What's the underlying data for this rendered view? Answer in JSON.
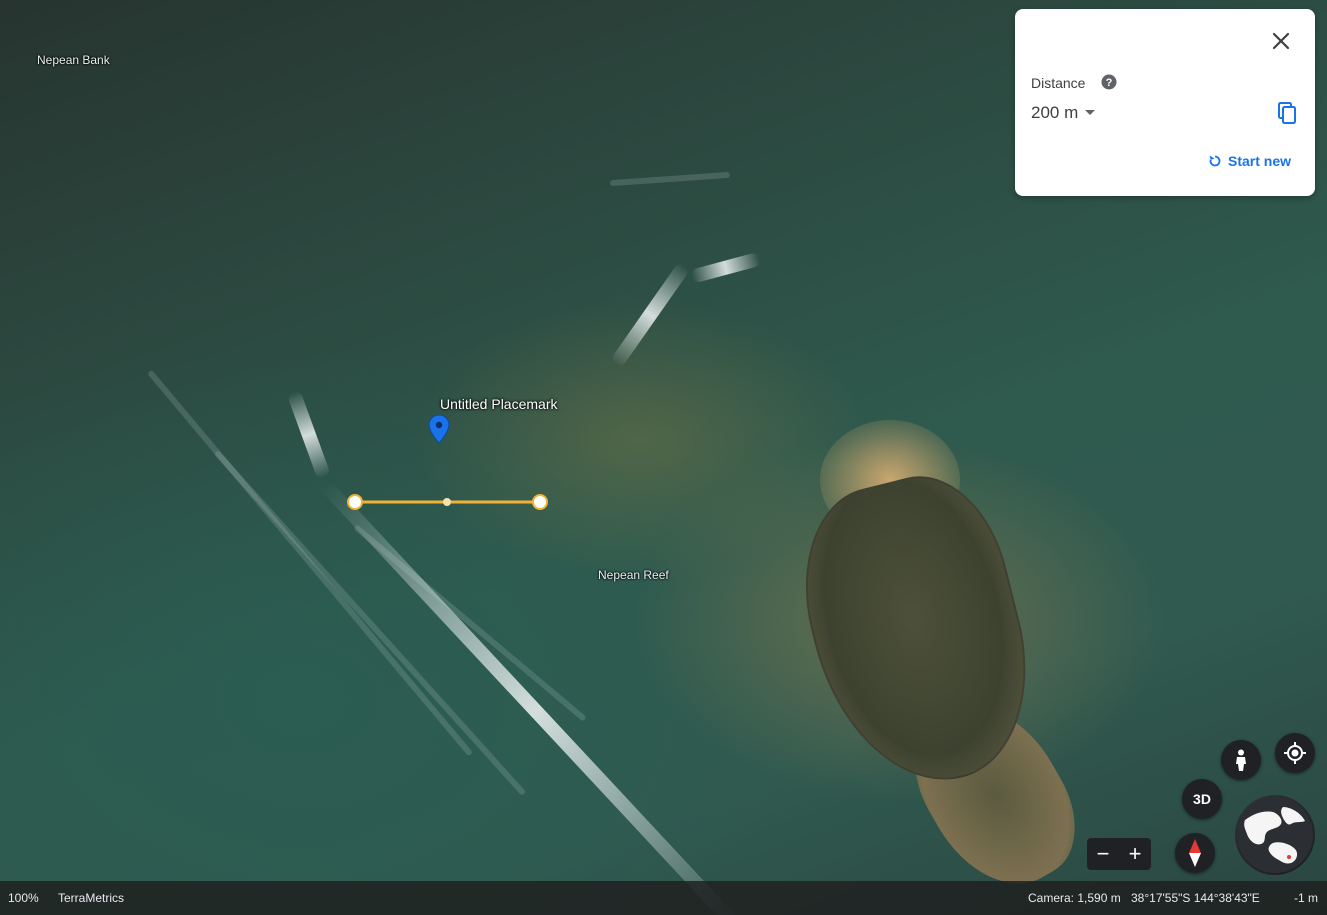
{
  "map": {
    "labels": {
      "nepean_bank": "Nepean Bank",
      "nepean_reef": "Nepean Reef",
      "placemark": "Untitled Placemark"
    }
  },
  "measure_panel": {
    "distance_label": "Distance",
    "distance_value": "200 m",
    "start_new_label": "Start new"
  },
  "controls": {
    "three_d_label": "3D",
    "zoom_out": "−",
    "zoom_in": "+"
  },
  "status_bar": {
    "zoom_percent": "100%",
    "attribution": "TerraMetrics",
    "camera": "Camera: 1,590 m",
    "coordinates": "38°17'55\"S 144°38'43\"E",
    "elevation": "-1 m"
  },
  "colors": {
    "measure_line": "#f2b237",
    "accent": "#1a73e8",
    "pin": "#1a73e8"
  },
  "icons": [
    "close-icon",
    "help-icon",
    "dropdown-arrow-icon",
    "copy-icon",
    "restart-icon",
    "pegman-icon",
    "my-location-icon",
    "compass-icon",
    "globe-icon",
    "placemark-pin-icon"
  ]
}
